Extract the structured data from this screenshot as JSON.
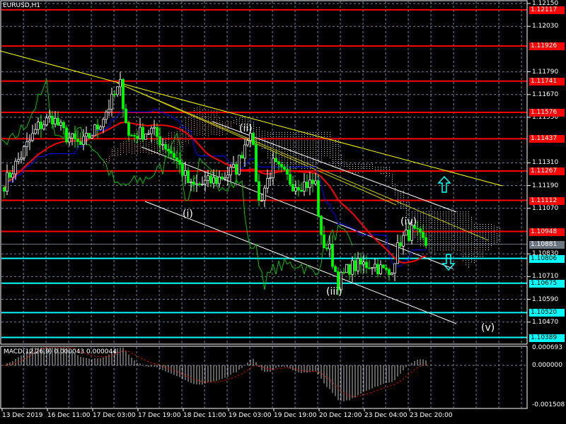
{
  "symbol_title": "EURUSD,H1",
  "macd_title": "MACD(12,26,9) 0.000043 0.000044",
  "colors": {
    "background": "#000000",
    "grid": "#6f7f93",
    "bull": "#ffffff",
    "bear": "#00ff00",
    "red_level": "#ff0000",
    "cyan_level": "#00ffff",
    "current": "#6b7580",
    "trend_yellow": "#ffff00",
    "ma": "#ff0000",
    "kijun": "#0000ff",
    "chikou": "#00c000"
  },
  "price_axis": [
    "1.12150",
    "1.12030",
    "1.11790",
    "1.11670",
    "1.11550",
    "1.11310",
    "1.11190",
    "1.11070",
    "1.10830",
    "1.10710",
    "1.10590",
    "1.10470"
  ],
  "macd_axis": [
    "0.000693",
    "0.000000",
    "-0.001508"
  ],
  "red_levels": [
    "1.12117",
    "1.11926",
    "1.11741",
    "1.11576",
    "1.11437",
    "1.11267",
    "1.11112",
    "1.10948"
  ],
  "cyan_levels": [
    "1.10806",
    "1.10675",
    "1.10520",
    "1.10389"
  ],
  "current_price": "1.10881",
  "time_axis": [
    "13 Dec 2019",
    "16 Dec 11:00",
    "17 Dec 03:00",
    "17 Dec 19:00",
    "18 Dec 11:00",
    "19 Dec 03:00",
    "19 Dec 19:00",
    "20 Dec 12:00",
    "23 Dec 04:00",
    "23 Dec 20:00"
  ],
  "waves": [
    "(i)",
    "(ii)",
    "(iii)",
    "(iv)",
    "(v)"
  ],
  "chart_data": {
    "type": "candlestick",
    "title": "EURUSD,H1",
    "ylim": [
      1.1035,
      1.1217
    ],
    "close_anchors": [
      [
        0,
        1.112
      ],
      [
        4,
        1.113
      ],
      [
        12,
        1.115
      ],
      [
        17,
        1.1155
      ],
      [
        22,
        1.1145
      ],
      [
        27,
        1.114
      ],
      [
        33,
        1.115
      ],
      [
        41,
        1.1172
      ],
      [
        44,
        1.1145
      ],
      [
        52,
        1.1148
      ],
      [
        60,
        1.1135
      ],
      [
        66,
        1.1118
      ],
      [
        75,
        1.1122
      ],
      [
        82,
        1.1128
      ],
      [
        87,
        1.115
      ],
      [
        90,
        1.111
      ],
      [
        95,
        1.113
      ],
      [
        102,
        1.112
      ],
      [
        110,
        1.112
      ],
      [
        112,
        1.109
      ],
      [
        115,
        1.1085
      ],
      [
        118,
        1.1068
      ],
      [
        122,
        1.1076
      ],
      [
        130,
        1.1078
      ],
      [
        136,
        1.1072
      ],
      [
        140,
        1.109
      ],
      [
        144,
        1.1095
      ],
      [
        149,
        1.1088
      ]
    ],
    "indicator": "MACD(12,26,9)",
    "macd_main": 4.3e-05,
    "macd_signal": 4.4e-05
  }
}
